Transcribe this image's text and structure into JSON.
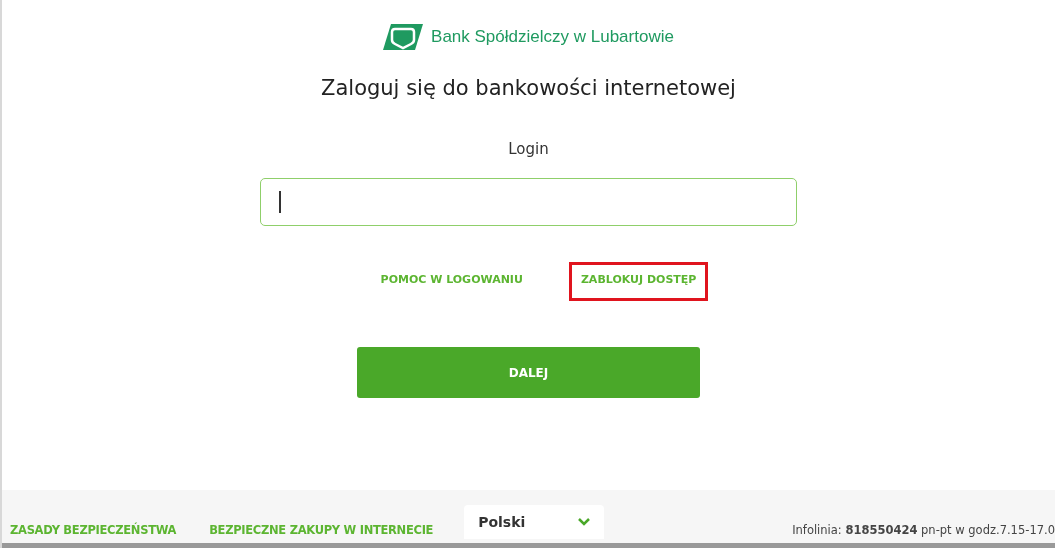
{
  "header": {
    "bank_name": "Bank Spółdzielczy w Lubartowie"
  },
  "title": "Zaloguj się do bankowości internetowej",
  "login": {
    "label": "Login",
    "focused": true
  },
  "links": [
    {
      "label": "POMOC W LOGOWANIU",
      "highlighted": false
    },
    {
      "label": "ZABLOKUJ DOSTĘP",
      "highlighted": true
    }
  ],
  "submit": "DALEJ",
  "footer": {
    "links": [
      "ZASADY BEZPIECZEŃSTWA",
      "BEZPIECZNE ZAKUPY W INTERNECIE"
    ],
    "language": "Polski",
    "hotline": "Infolinia: **818550424** pn-pt w godz.7.15-17.0"
  }
}
